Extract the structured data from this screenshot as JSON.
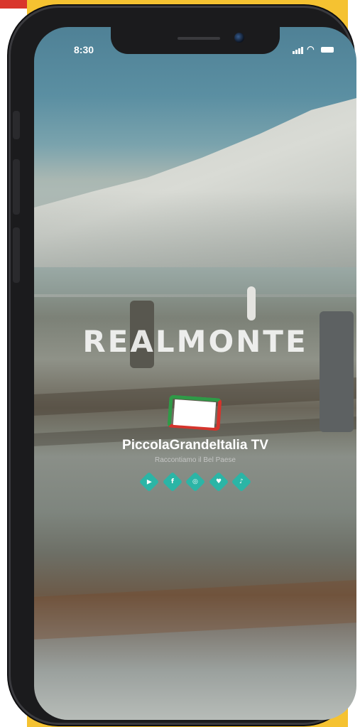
{
  "status_bar": {
    "time": "8:30"
  },
  "splash": {
    "city_name": "REALMONTE",
    "brand_name": "PiccolaGrandeItalia TV",
    "tagline": "Raccontiamo il Bel Paese",
    "social_icons": [
      {
        "icon": "youtube-icon",
        "glyph": "▶"
      },
      {
        "icon": "facebook-icon",
        "glyph": "f"
      },
      {
        "icon": "instagram-icon",
        "glyph": "◎"
      },
      {
        "icon": "twitter-icon",
        "glyph": "♥"
      },
      {
        "icon": "tiktok-icon",
        "glyph": "♪"
      }
    ]
  },
  "colors": {
    "accent": "#2bb5a6",
    "frame": "#f5c231",
    "logo_red": "#d5342c",
    "logo_green": "#2f9a47"
  }
}
